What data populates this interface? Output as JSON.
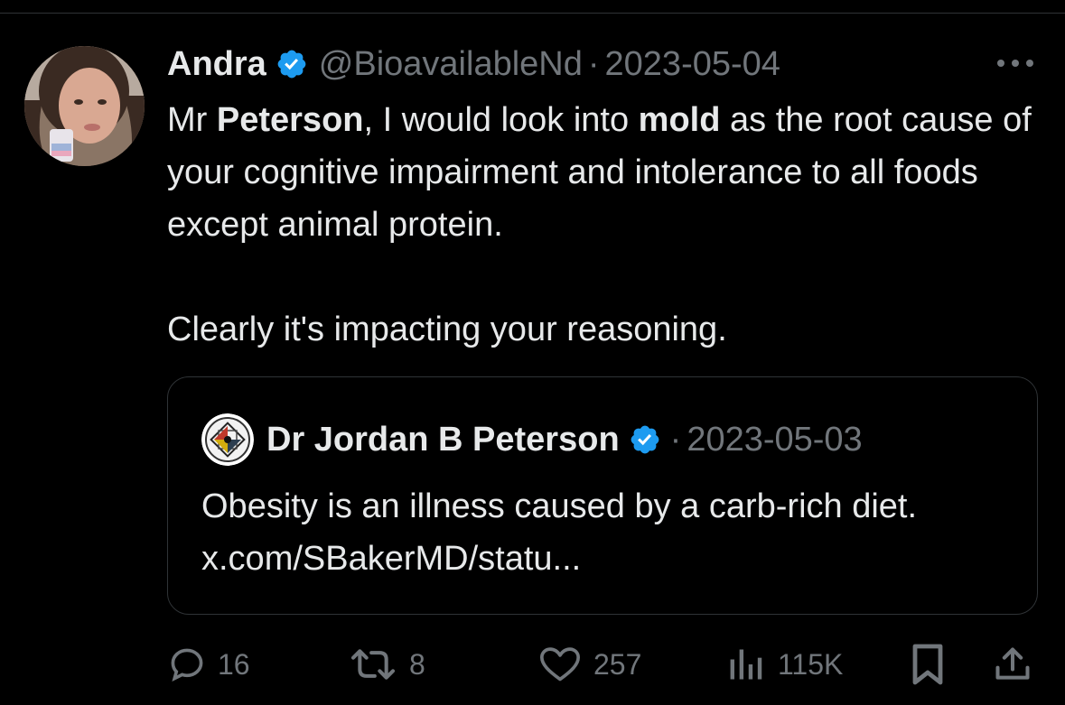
{
  "tweet": {
    "author": {
      "display_name": "Andra",
      "handle": "@BioavailableNd",
      "verified": true
    },
    "separator": "·",
    "date": "2023-05-04",
    "text": {
      "line1_pre": "Mr ",
      "line1_bold1": "Peterson",
      "line1_mid": ", I would look into ",
      "line1_bold2": "mold",
      "line1_post": " as the root cause of your cognitive impairment and intolerance to all foods except animal protein.",
      "line2": "Clearly it's impacting your reasoning."
    },
    "more_icon": "more-horizontal-icon"
  },
  "quoted_tweet": {
    "author": {
      "display_name": "Dr Jordan B Peterson",
      "verified": true
    },
    "separator": "·",
    "date": "2023-05-03",
    "text": "Obesity is an illness caused by a carb-rich diet. x.com/SBakerMD/statu..."
  },
  "actions": {
    "replies": "16",
    "retweets": "8",
    "likes": "257",
    "views": "115K",
    "icons": [
      "reply-icon",
      "retweet-icon",
      "like-icon",
      "views-icon",
      "bookmark-icon",
      "share-icon"
    ]
  },
  "colors": {
    "background": "#000000",
    "text_primary": "#e7e9ea",
    "text_secondary": "#71767b",
    "verified_blue": "#1d9bf0",
    "border": "#2f3336"
  }
}
